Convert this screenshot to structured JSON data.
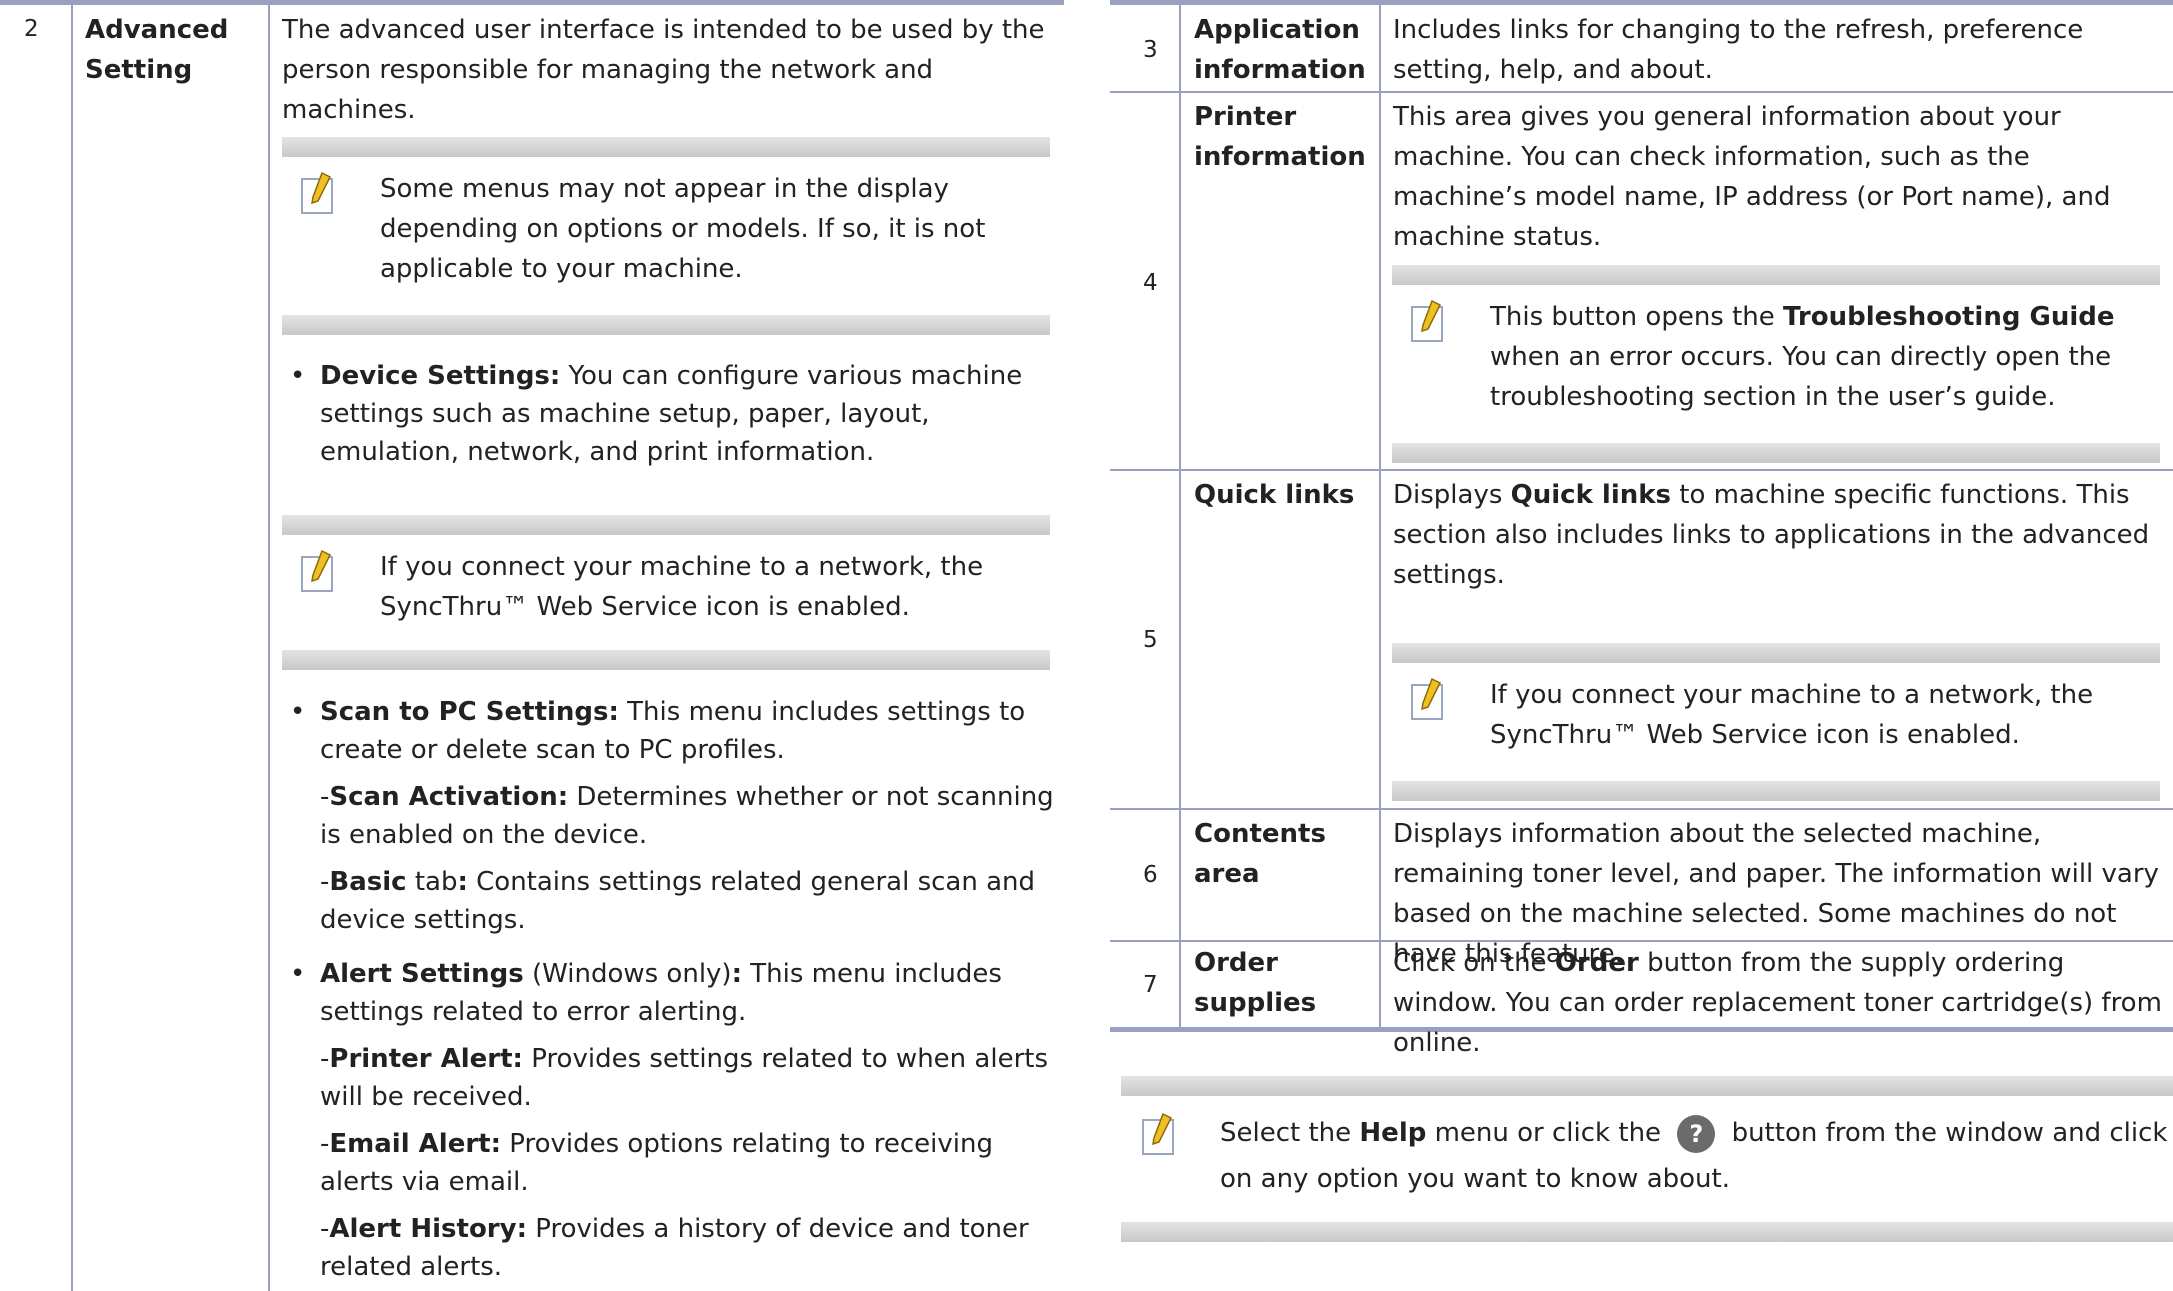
{
  "left_table": {
    "row_number": "2",
    "row_label": [
      "Advanced",
      "Setting"
    ],
    "intro": "The advanced user interface is intended to be used by the person responsible for managing the network and machines.",
    "note1": "Some menus may not appear in the display depending on options or models. If so, it is not applicable to your machine.",
    "device_settings_title": "Device Settings:",
    "device_settings_text": " You can configure various machine settings such as machine setup, paper, layout, emulation, network, and print information.",
    "note2": "If you connect your machine to a network, the SyncThru™ Web Service icon is enabled.",
    "scan_title": "Scan to PC Settings:",
    "scan_text": " This menu includes settings to create or delete scan to PC profiles.",
    "scan_activation_title": "Scan Activation:",
    "scan_activation_text": " Determines whether or not scanning is enabled on the device.",
    "basic_title": "Basic",
    "basic_mid": " tab",
    "basic_colon": ":",
    "basic_text": " Contains settings related general scan and device settings.",
    "alert_title": "Alert Settings",
    "alert_mid": " (Windows only)",
    "alert_colon": ":",
    "alert_text": " This menu includes settings related to error alerting.",
    "printer_alert_title": "Printer Alert:",
    "printer_alert_text": " Provides settings related to when alerts will be received.",
    "email_alert_title": "Email Alert:",
    "email_alert_text": " Provides options relating to receiving alerts via email.",
    "alert_history_title": "Alert History:",
    "alert_history_text": " Provides a history of device and toner related alerts."
  },
  "right_table": {
    "rows": [
      {
        "num": "3",
        "label": [
          "Application",
          "information"
        ],
        "text": "Includes links for changing to the refresh, preference setting, help, and about."
      },
      {
        "num": "4",
        "label": [
          "Printer",
          "information"
        ],
        "text": "This area gives you general information about your machine. You can check information, such as the machine’s model name, IP address (or Port name), and machine status."
      },
      {
        "num": "5",
        "label": [
          "Quick links"
        ],
        "text_pre": "Displays ",
        "text_bold": "Quick links",
        "text_post": " to machine specific functions. This section also includes links to applications in the advanced settings."
      },
      {
        "num": "6",
        "label": [
          "Contents",
          "area"
        ],
        "text": "Displays information about the selected machine, remaining toner level, and paper. The information will vary based on the machine selected. Some machines do not have this feature."
      },
      {
        "num": "7",
        "label": [
          "Order",
          "supplies"
        ],
        "text_pre": "Click on the ",
        "text_bold": "Order",
        "text_post": " button from the supply ordering window. You can order replacement toner cartridge(s) from online."
      }
    ],
    "note_row4_pre": "This button opens the ",
    "note_row4_bold": "Troubleshooting Guide",
    "note_row4_post": " when an error occurs. You can directly open the troubleshooting section in the user’s guide.",
    "note_row5": "If you connect your machine to a network, the SyncThru™ Web Service icon is enabled."
  },
  "bottom_note": {
    "pre": "Select the ",
    "bold": "Help",
    "mid": " menu or click the ",
    "icon_glyph": "?",
    "post": " button from the window and click on any option you want to know about."
  },
  "colors": {
    "rule": "#9aa0c0",
    "note_bar": "#d0d0d0",
    "pencil": "#f0c020"
  }
}
